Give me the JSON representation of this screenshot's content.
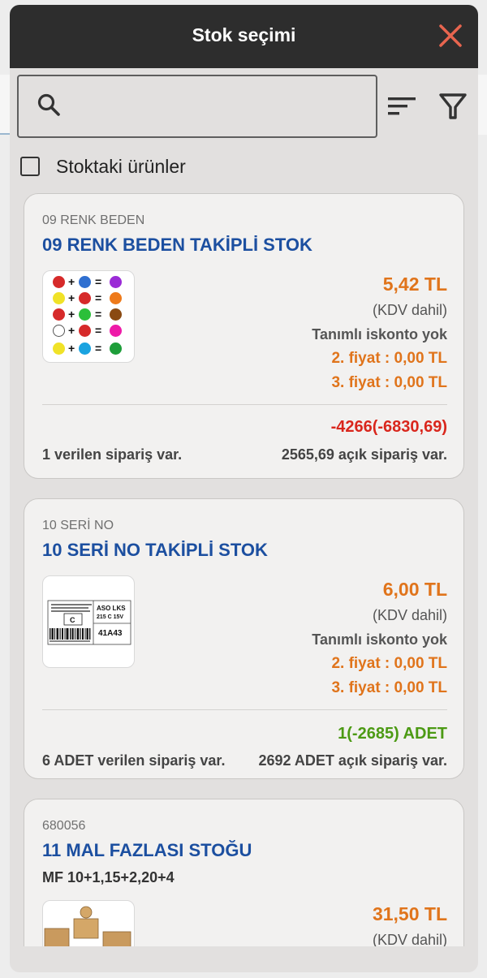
{
  "modal": {
    "title": "Stok seçimi",
    "close_icon": "close-icon"
  },
  "search": {
    "value": "",
    "placeholder": ""
  },
  "toolbar": {
    "sort_icon": "sort-icon",
    "filter_icon": "filter-icon"
  },
  "stock_filter": {
    "label": "Stoktaki ürünler",
    "checked": false
  },
  "products": [
    {
      "code": "09 RENK BEDEN",
      "name": "09 RENK BEDEN TAKİPLİ STOK",
      "image": "color-mixing-chart",
      "price": "5,42 TL",
      "vat": "(KDV dahil)",
      "discount": "Tanımlı iskonto yok",
      "price2": "2. fiyat : 0,00 TL",
      "price3": "3. fiyat : 0,00 TL",
      "stock": "-4266(-6830,69)",
      "stock_color": "#d9261c",
      "given_orders": "1  verilen sipariş var.",
      "open_orders": "2565,69  açık sipariş var."
    },
    {
      "code": "10 SERİ NO",
      "name": "10 SERİ NO TAKİPLİ STOK",
      "image": "barcode-label",
      "label_lines": [
        "ASO LKS",
        "215 C 15V",
        "C",
        "41A43"
      ],
      "price": "6,00 TL",
      "vat": "(KDV dahil)",
      "discount": "Tanımlı iskonto yok",
      "price2": "2. fiyat : 0,00 TL",
      "price3": "3. fiyat : 0,00 TL",
      "stock": "1(-2685) ADET",
      "stock_color": "#4c9a14",
      "given_orders": "6 ADET verilen sipariş var.",
      "open_orders": "2692 ADET açık sipariş var."
    },
    {
      "code": "680056",
      "name": "11 MAL FAZLASI STOĞU",
      "subtitle": "MF 10+1,15+2,20+4",
      "image": "cardboard-boxes",
      "price": "31,50 TL",
      "vat": "(KDV dahil)"
    }
  ],
  "colors": {
    "header_bg": "#2d2d2d",
    "accent_orange": "#e0741b",
    "title_blue": "#1c4fa0",
    "close_red": "#e8654f"
  }
}
